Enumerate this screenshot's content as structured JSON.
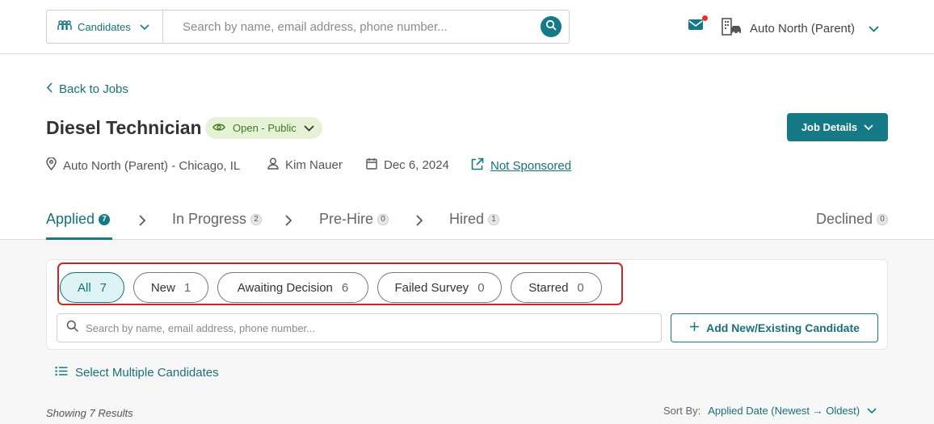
{
  "topbar": {
    "scope_label": "Candidates",
    "search_placeholder": "Search by name, email address, phone number...",
    "org_name": "Auto North (Parent)"
  },
  "header": {
    "back_label": "Back to Jobs",
    "job_title": "Diesel Technician",
    "status": "Open - Public",
    "job_details_label": "Job Details",
    "location": "Auto North (Parent) - Chicago, IL",
    "recruiter": "Kim Nauer",
    "date": "Dec 6, 2024",
    "sponsorship": "Not Sponsored"
  },
  "stages": [
    {
      "label": "Applied",
      "count": "7"
    },
    {
      "label": "In Progress",
      "count": "2"
    },
    {
      "label": "Pre-Hire",
      "count": "0"
    },
    {
      "label": "Hired",
      "count": "1"
    },
    {
      "label": "Declined",
      "count": "0"
    }
  ],
  "filters": [
    {
      "label": "All",
      "count": "7"
    },
    {
      "label": "New",
      "count": "1"
    },
    {
      "label": "Awaiting Decision",
      "count": "6"
    },
    {
      "label": "Failed Survey",
      "count": "0"
    },
    {
      "label": "Starred",
      "count": "0"
    }
  ],
  "candidate_search": {
    "placeholder": "Search by name, email address, phone number..."
  },
  "add_candidate_label": "Add New/Existing Candidate",
  "select_multiple_label": "Select Multiple Candidates",
  "results_text": "Showing 7 Results",
  "sort": {
    "label": "Sort By:",
    "value": "Applied Date (Newest → Oldest)"
  },
  "colors": {
    "accent": "#157a85",
    "status_bg": "#e6f2d5",
    "highlight_border": "#c62828"
  }
}
